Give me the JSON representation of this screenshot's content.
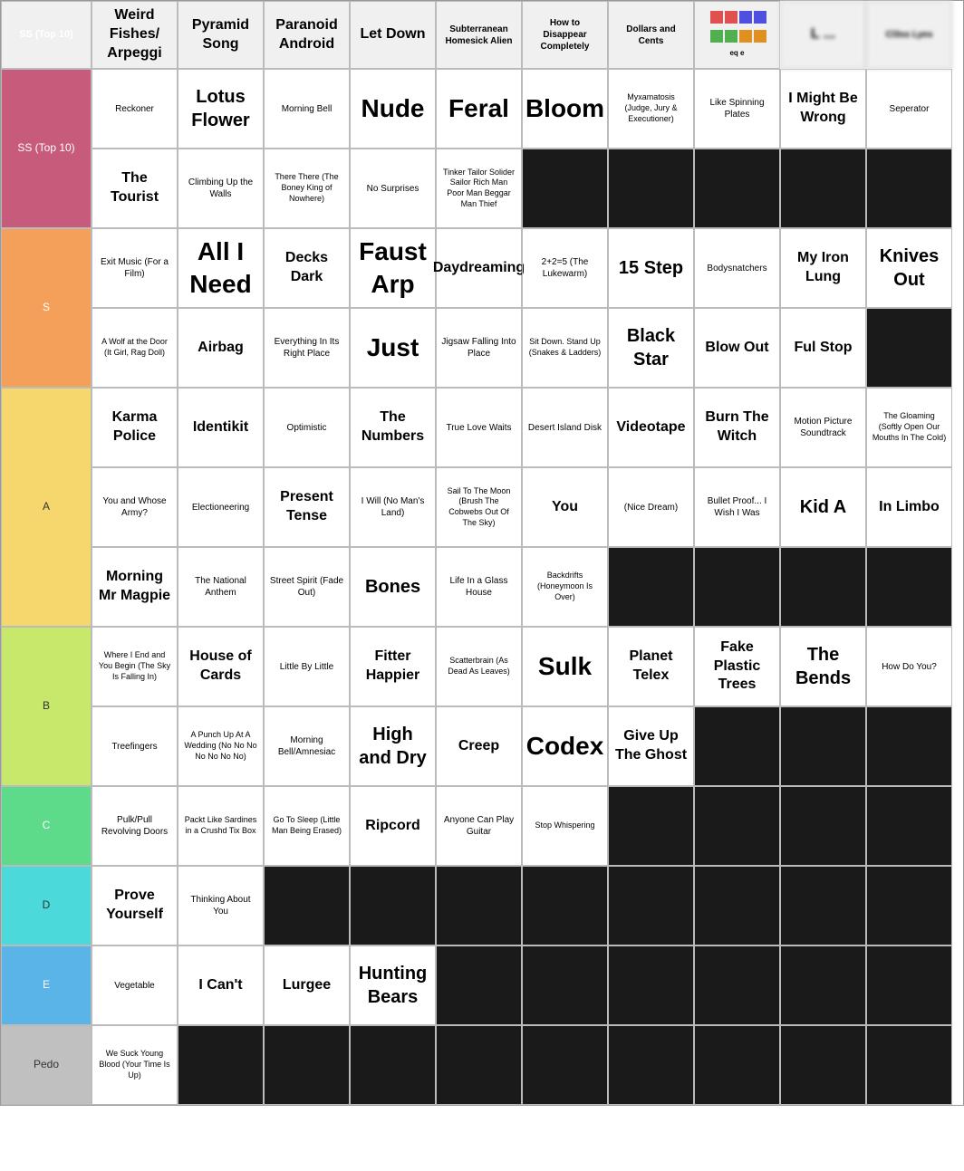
{
  "tiers": {
    "ss": "SS (Top 10)",
    "s": "S",
    "a": "A",
    "b": "B",
    "c": "C",
    "d": "D",
    "e": "E",
    "pedo": "Pedo"
  },
  "header": {
    "col1": "",
    "col2": "Weird Fishes/ Arpeggi",
    "col3": "Pyramid Song",
    "col4": "Paranoid Android",
    "col5": "Let Down",
    "col6": "Subterranean Homesick Alien",
    "col7": "How to Disappear Completely",
    "col8": "Dollars and Cents",
    "col9": "dots",
    "col10": "L...",
    "col11": "Cl3ss Lyes"
  }
}
